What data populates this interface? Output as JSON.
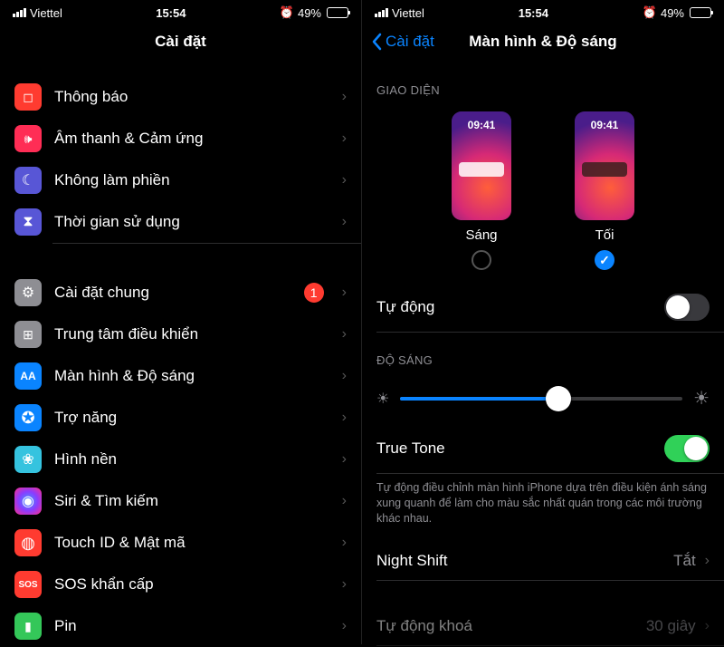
{
  "status": {
    "carrier": "Viettel",
    "time": "15:54",
    "battery": "49%",
    "alarm_icon": "⏰"
  },
  "left": {
    "title": "Cài đặt",
    "items": [
      {
        "label": "Thông báo",
        "icon_bg": "#ff3b30",
        "glyph": "◻︎"
      },
      {
        "label": "Âm thanh & Cảm ứng",
        "icon_bg": "#ff2d55",
        "glyph": "🔊"
      },
      {
        "label": "Không làm phiền",
        "icon_bg": "#5856d6",
        "glyph": "☾"
      },
      {
        "label": "Thời gian sử dụng",
        "icon_bg": "#5856d6",
        "glyph": "⧗"
      }
    ],
    "items2": [
      {
        "label": "Cài đặt chung",
        "icon_bg": "#8e8e93",
        "glyph": "⚙︎",
        "badge": "1"
      },
      {
        "label": "Trung tâm điều khiển",
        "icon_bg": "#8e8e93",
        "glyph": "⊞"
      },
      {
        "label": "Màn hình & Độ sáng",
        "icon_bg": "#0a84ff",
        "glyph": "AA"
      },
      {
        "label": "Trợ năng",
        "icon_bg": "#0a84ff",
        "glyph": "✪"
      },
      {
        "label": "Hình nền",
        "icon_bg": "#54c7ec",
        "glyph": "❀"
      },
      {
        "label": "Siri & Tìm kiếm",
        "icon_bg": "#1c1c1e",
        "glyph": "◉"
      },
      {
        "label": "Touch ID & Mật mã",
        "icon_bg": "#ff3b30",
        "glyph": "𖠚"
      },
      {
        "label": "SOS khẩn cấp",
        "icon_bg": "#ff3b30",
        "glyph": "SOS"
      },
      {
        "label": "Pin",
        "icon_bg": "#34c759",
        "glyph": "▮"
      }
    ]
  },
  "right": {
    "back": "Cài đặt",
    "title": "Màn hình & Độ sáng",
    "appearance_header": "GIAO DIỆN",
    "phone_time": "09:41",
    "light_label": "Sáng",
    "dark_label": "Tối",
    "automatic_label": "Tự động",
    "brightness_header": "ĐỘ SÁNG",
    "truetone_label": "True Tone",
    "truetone_note": "Tự động điều chỉnh màn hình iPhone dựa trên điều kiện ánh sáng xung quanh để làm cho màu sắc nhất quán trong các môi trường khác nhau.",
    "nightshift_label": "Night Shift",
    "nightshift_value": "Tắt",
    "autolock_label": "Tự động khoá",
    "autolock_value": "30 giây"
  }
}
